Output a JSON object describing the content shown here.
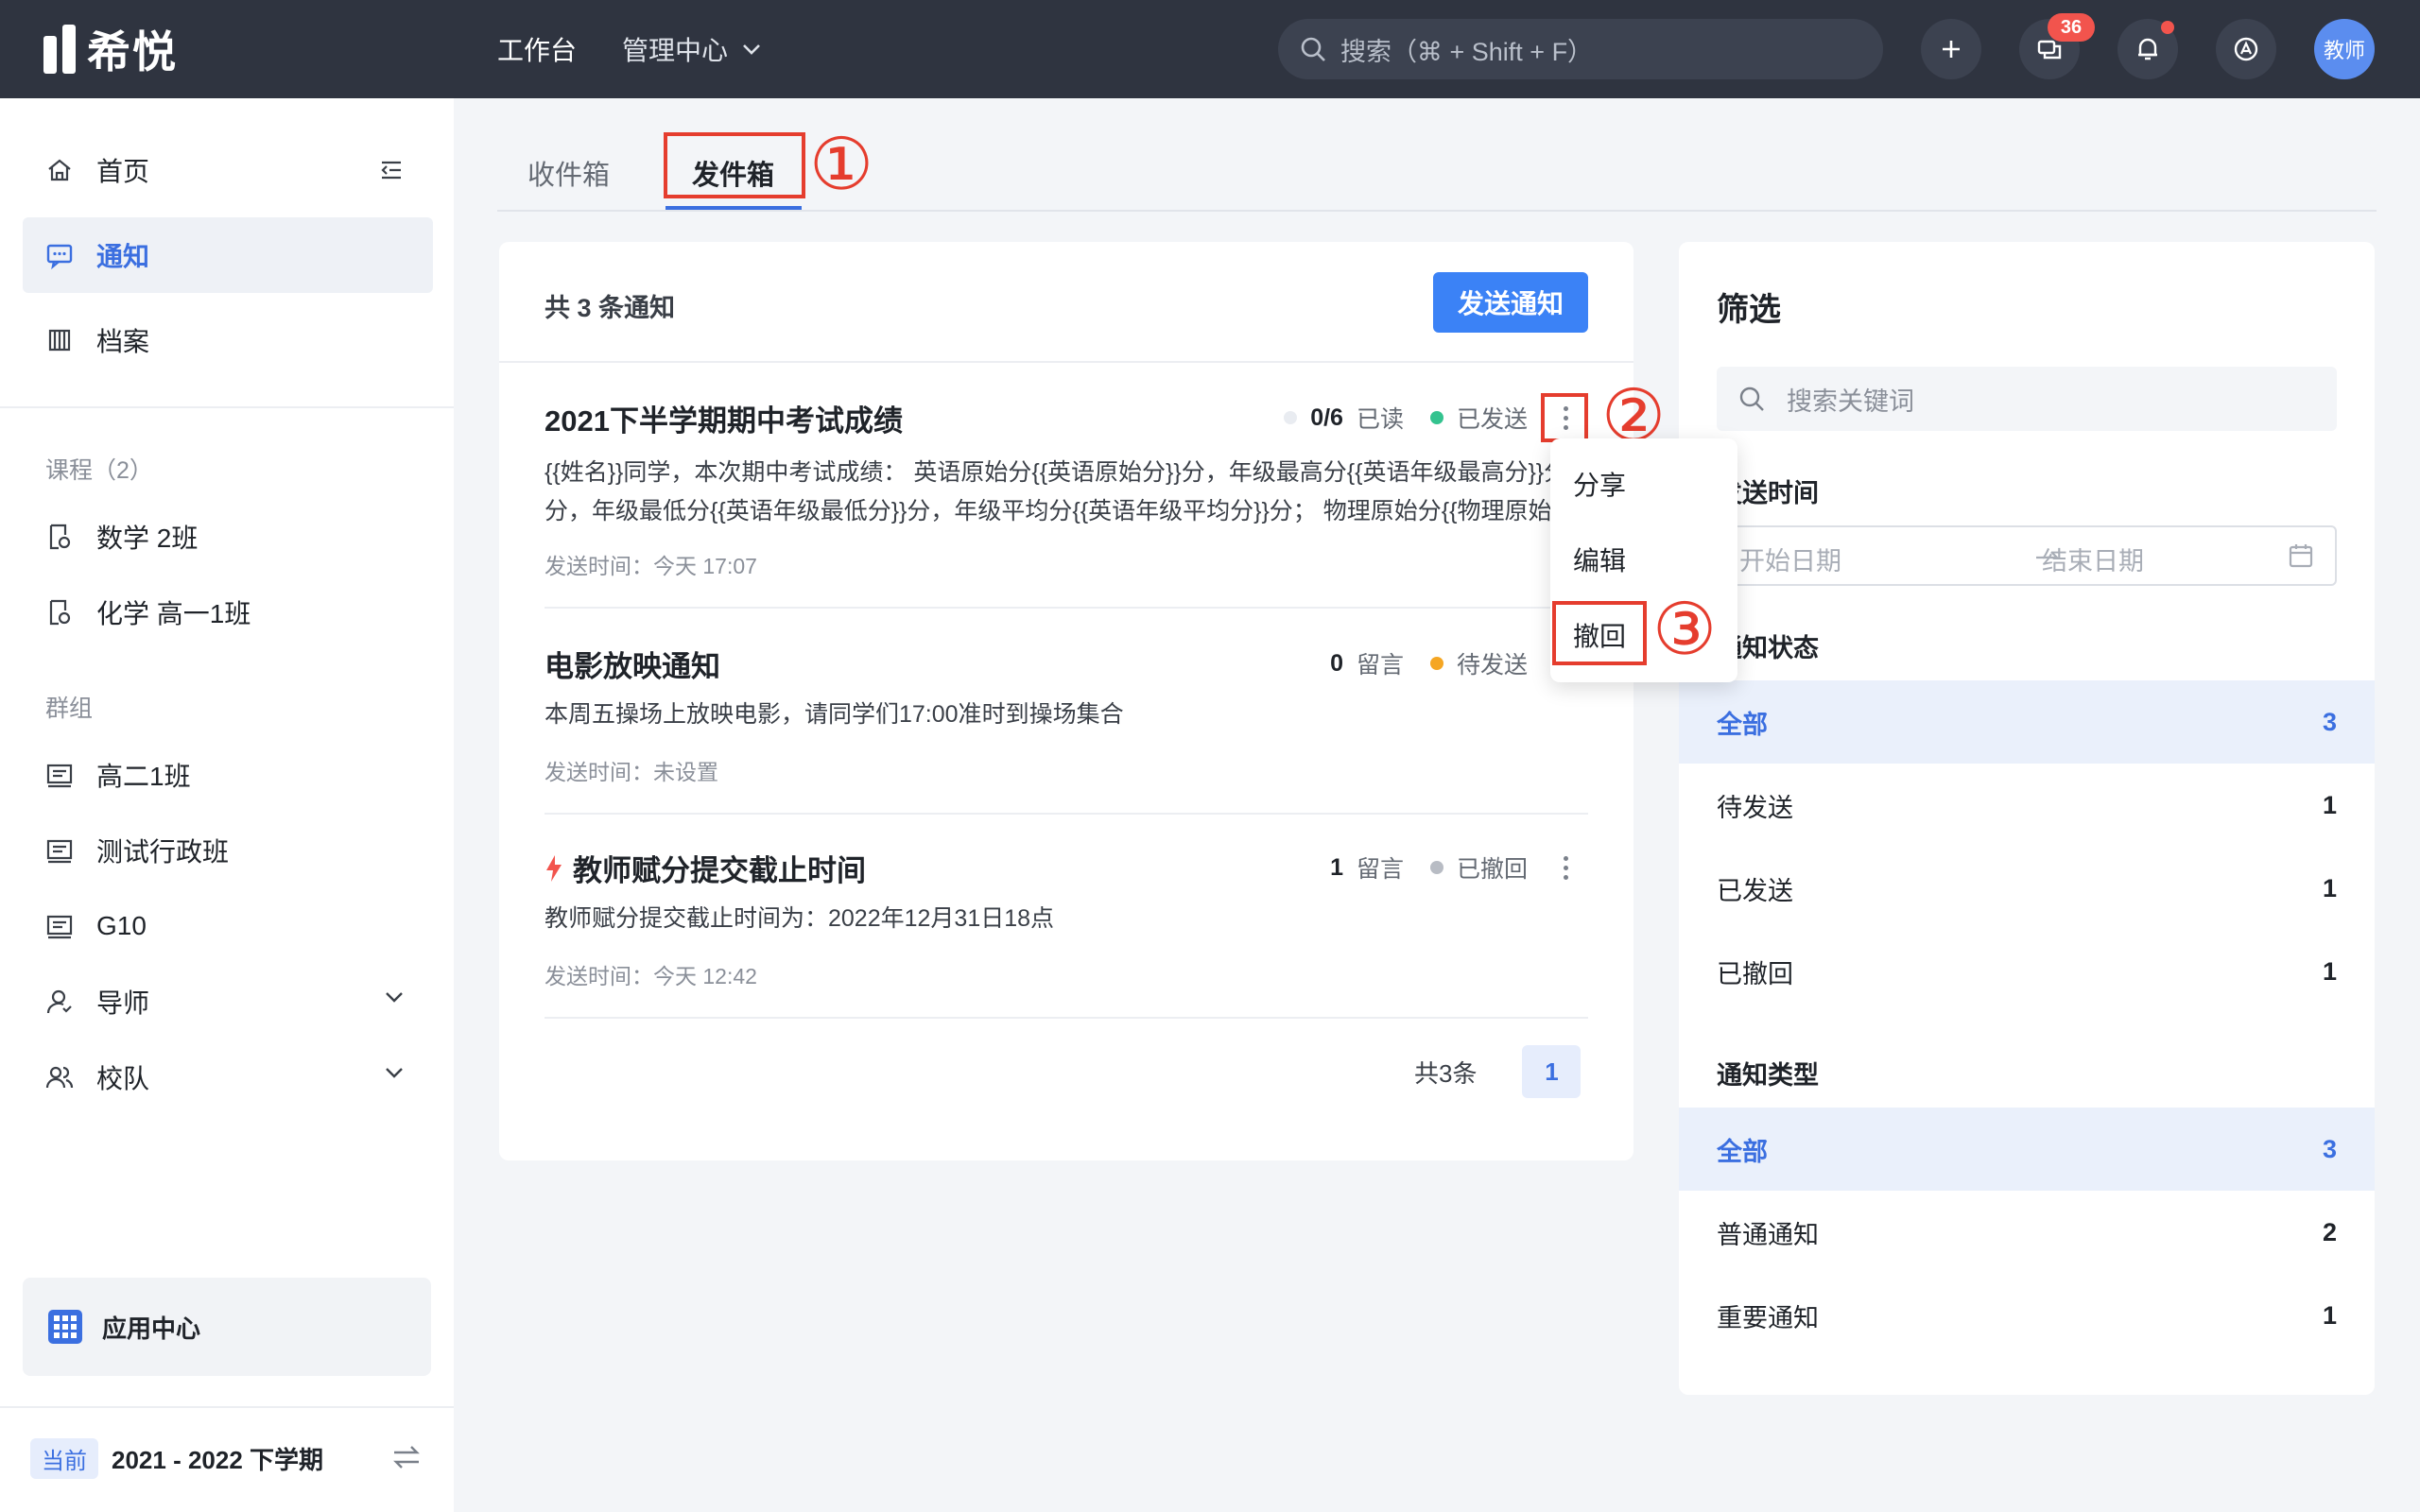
{
  "brand": {
    "name": "希悦"
  },
  "topnav": {
    "workbench": "工作台",
    "admin": "管理中心"
  },
  "search": {
    "placeholder": "搜索（⌘ + Shift + F）"
  },
  "topbar": {
    "message_badge": "36",
    "avatar_label": "教师"
  },
  "sidebar": {
    "home": "首页",
    "notice": "通知",
    "archive": "档案",
    "courses_label": "课程（2）",
    "courses": [
      "数学 2班",
      "化学 高一1班"
    ],
    "groups_label": "群组",
    "groups": [
      "高二1班",
      "测试行政班",
      "G10"
    ],
    "mentor": "导师",
    "team": "校队",
    "app_center": "应用中心",
    "term_tag": "当前",
    "term": "2021 - 2022 下学期"
  },
  "tabs": {
    "inbox": "收件箱",
    "outbox": "发件箱"
  },
  "annotations": {
    "one": "①",
    "two": "②",
    "three": "③"
  },
  "list": {
    "count_text": "共 3 条通知",
    "send_button": "发送通知",
    "notices": [
      {
        "title": "2021下半学期期中考试成绩",
        "read_count": "0/6",
        "read_label": "已读",
        "status": "已发送",
        "status_color": "#34c38f",
        "body_line1": "{{姓名}}同学，本次期中考试成绩： 英语原始分{{英语原始分}}分，年级最高分{{英语年级最高分}}分，",
        "body_line2": "分，年级最低分{{英语年级最低分}}分，年级平均分{{英语年级平均分}}分； 物理原始分{{物理原始分}}分",
        "time": "发送时间：今天 17:07"
      },
      {
        "title": "电影放映通知",
        "comment_count": "0",
        "comment_label": "留言",
        "status": "待发送",
        "status_color": "#f5a623",
        "body": "本周五操场上放映电影，请同学们17:00准时到操场集合",
        "time": "发送时间：未设置"
      },
      {
        "title": "教师赋分提交截止时间",
        "comment_count": "1",
        "comment_label": "留言",
        "status": "已撤回",
        "status_color": "#b8bcc4",
        "body": "教师赋分提交截止时间为：2022年12月31日18点",
        "time": "发送时间：今天 12:42"
      }
    ],
    "pager_total": "共3条",
    "pager_page": "1"
  },
  "context_menu": {
    "share": "分享",
    "edit": "编辑",
    "recall": "撤回"
  },
  "filter": {
    "title": "筛选",
    "keyword_placeholder": "搜索关键词",
    "send_time_label": "发送时间",
    "start_date": "开始日期",
    "end_date": "结束日期",
    "status_label": "通知状态",
    "status_options": [
      {
        "label": "全部",
        "count": "3"
      },
      {
        "label": "待发送",
        "count": "1"
      },
      {
        "label": "已发送",
        "count": "1"
      },
      {
        "label": "已撤回",
        "count": "1"
      }
    ],
    "type_label": "通知类型",
    "type_options": [
      {
        "label": "全部",
        "count": "3"
      },
      {
        "label": "普通通知",
        "count": "2"
      },
      {
        "label": "重要通知",
        "count": "1"
      }
    ]
  },
  "colors": {
    "accent": "#3b82f6",
    "annotation": "#e53d2e",
    "topbar": "#2f3440"
  }
}
